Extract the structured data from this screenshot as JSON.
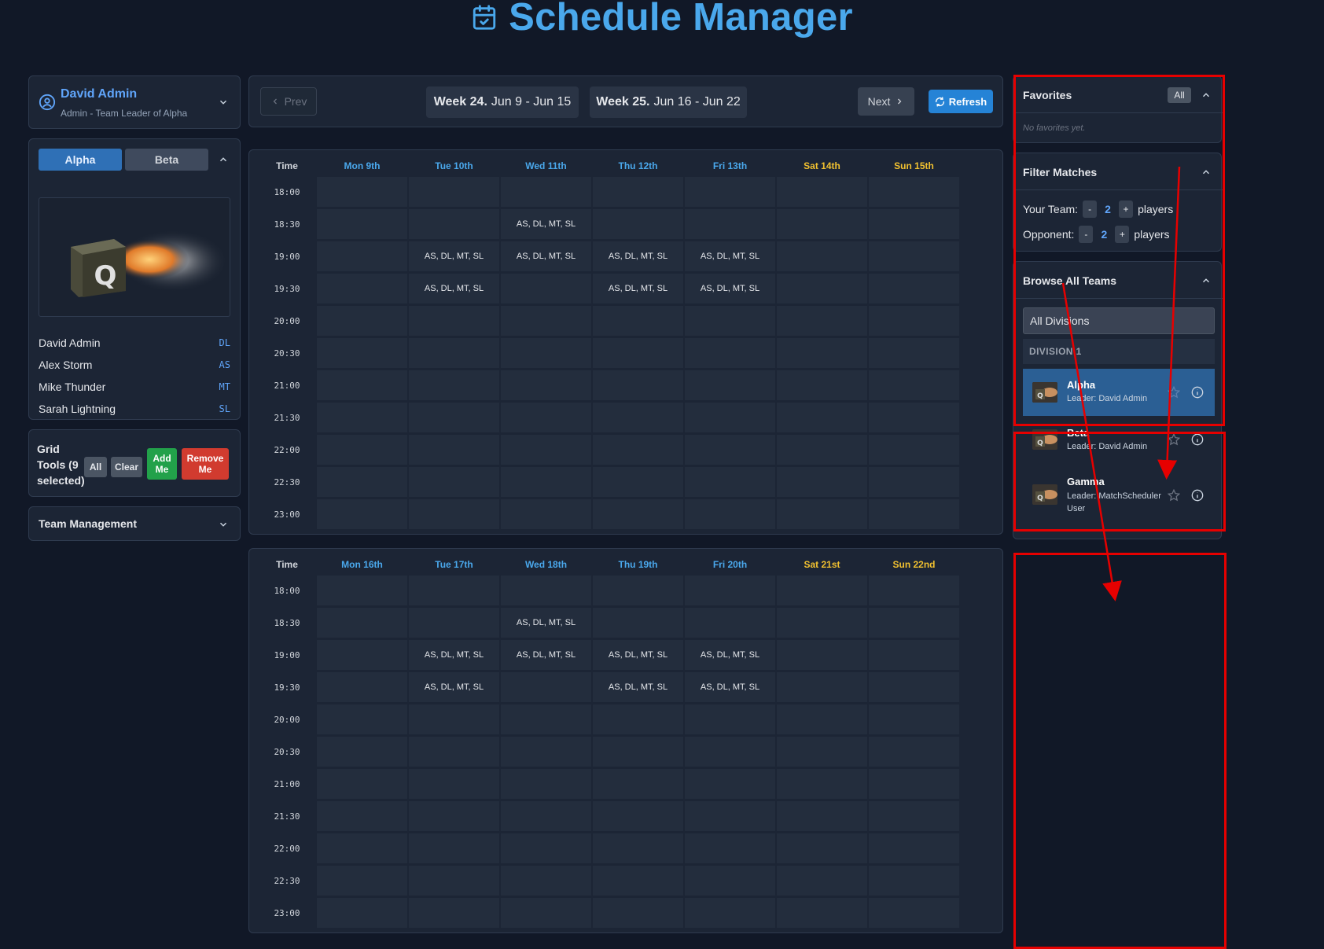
{
  "app": {
    "title": "Schedule Manager"
  },
  "user": {
    "name": "David Admin",
    "role": "Admin - Team Leader of Alpha"
  },
  "teams_tabs": [
    {
      "label": "Alpha",
      "active": true
    },
    {
      "label": "Beta",
      "active": false
    }
  ],
  "roster": [
    {
      "name": "David Admin",
      "initials": "DL"
    },
    {
      "name": "Alex Storm",
      "initials": "AS"
    },
    {
      "name": "Mike Thunder",
      "initials": "MT"
    },
    {
      "name": "Sarah Lightning",
      "initials": "SL"
    }
  ],
  "grid_tools": {
    "label": "Grid Tools (9 selected)",
    "all": "All",
    "clear": "Clear",
    "add_me": "Add Me",
    "remove_me": "Remove Me"
  },
  "team_management": {
    "label": "Team Management"
  },
  "week_nav": {
    "prev": "Prev",
    "next": "Next",
    "refresh": "Refresh",
    "week1_bold": "Week 24.",
    "week1_range": "Jun 9 - Jun 15",
    "week2_bold": "Week 25.",
    "week2_range": "Jun 16 - Jun 22"
  },
  "grid": {
    "time_header": "Time",
    "times": [
      "18:00",
      "18:30",
      "19:00",
      "19:30",
      "20:00",
      "20:30",
      "21:00",
      "21:30",
      "22:00",
      "22:30",
      "23:00"
    ],
    "weeks": [
      {
        "days": [
          "Mon 9th",
          "Tue 10th",
          "Wed 11th",
          "Thu 12th",
          "Fri 13th",
          "Sat 14th",
          "Sun 15th"
        ],
        "cells": {
          "1-2": "AS, DL, MT, SL",
          "2-1": "AS, DL, MT, SL",
          "2-2": "AS, DL, MT, SL",
          "2-3": "AS, DL, MT, SL",
          "2-4": "AS, DL, MT, SL",
          "3-1": "AS, DL, MT, SL",
          "3-3": "AS, DL, MT, SL",
          "3-4": "AS, DL, MT, SL"
        }
      },
      {
        "days": [
          "Mon 16th",
          "Tue 17th",
          "Wed 18th",
          "Thu 19th",
          "Fri 20th",
          "Sat 21st",
          "Sun 22nd"
        ],
        "cells": {
          "1-2": "AS, DL, MT, SL",
          "2-1": "AS, DL, MT, SL",
          "2-2": "AS, DL, MT, SL",
          "2-3": "AS, DL, MT, SL",
          "2-4": "AS, DL, MT, SL",
          "3-1": "AS, DL, MT, SL",
          "3-3": "AS, DL, MT, SL",
          "3-4": "AS, DL, MT, SL"
        }
      }
    ],
    "weekday_color": "#4aa8ec",
    "weekend_color": "#f0c030"
  },
  "favorites": {
    "title": "Favorites",
    "all_label": "All",
    "empty": "No favorites yet."
  },
  "filter": {
    "title": "Filter Matches",
    "your_team_label": "Your Team:",
    "your_team_value": "2",
    "opponent_label": "Opponent:",
    "opponent_value": "2",
    "unit": "players",
    "minus": "-",
    "plus": "+"
  },
  "browse": {
    "title": "Browse All Teams",
    "division_select": "All Divisions",
    "division_header": "DIVISION 1",
    "teams": [
      {
        "name": "Alpha",
        "leader": "Leader: David Admin",
        "selected": true
      },
      {
        "name": "Beta",
        "leader": "Leader: David Admin",
        "selected": false
      },
      {
        "name": "Gamma",
        "leader": "Leader: MatchScheduler User",
        "selected": false
      }
    ]
  },
  "colors": {
    "accent": "#4aa8ec",
    "background": "#111827",
    "panel": "#1c2535",
    "annotation": "#e60000"
  },
  "icons": [
    "calendar-check-icon",
    "user-circle-icon",
    "chevron-down-icon",
    "chevron-up-icon",
    "chevron-left-icon",
    "chevron-right-icon",
    "refresh-icon",
    "star-icon",
    "info-icon"
  ]
}
